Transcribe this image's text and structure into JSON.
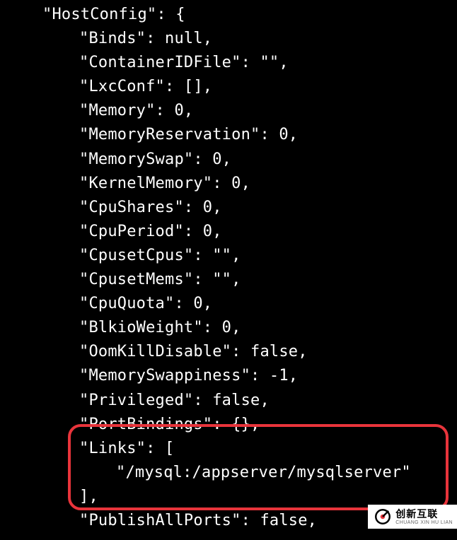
{
  "lines": [
    {
      "indent": 1,
      "text": "\"HostConfig\": {"
    },
    {
      "indent": 2,
      "text": "\"Binds\": null,"
    },
    {
      "indent": 2,
      "text": "\"ContainerIDFile\": \"\","
    },
    {
      "indent": 2,
      "text": "\"LxcConf\": [],"
    },
    {
      "indent": 2,
      "text": "\"Memory\": 0,"
    },
    {
      "indent": 2,
      "text": "\"MemoryReservation\": 0,"
    },
    {
      "indent": 2,
      "text": "\"MemorySwap\": 0,"
    },
    {
      "indent": 2,
      "text": "\"KernelMemory\": 0,"
    },
    {
      "indent": 2,
      "text": "\"CpuShares\": 0,"
    },
    {
      "indent": 2,
      "text": "\"CpuPeriod\": 0,"
    },
    {
      "indent": 2,
      "text": "\"CpusetCpus\": \"\","
    },
    {
      "indent": 2,
      "text": "\"CpusetMems\": \"\","
    },
    {
      "indent": 2,
      "text": "\"CpuQuota\": 0,"
    },
    {
      "indent": 2,
      "text": "\"BlkioWeight\": 0,"
    },
    {
      "indent": 2,
      "text": "\"OomKillDisable\": false,"
    },
    {
      "indent": 2,
      "text": "\"MemorySwappiness\": -1,"
    },
    {
      "indent": 2,
      "text": "\"Privileged\": false,"
    },
    {
      "indent": 2,
      "text": "\"PortBindings\": {},"
    },
    {
      "indent": 2,
      "text": "\"Links\": ["
    },
    {
      "indent": 3,
      "text": "\"/mysql:/appserver/mysqlserver\""
    },
    {
      "indent": 2,
      "text": "],"
    },
    {
      "indent": 2,
      "text": "\"PublishAllPorts\": false,"
    }
  ],
  "watermark": {
    "cn": "创新互联",
    "en": "CHUANG XIN HU LIAN"
  }
}
